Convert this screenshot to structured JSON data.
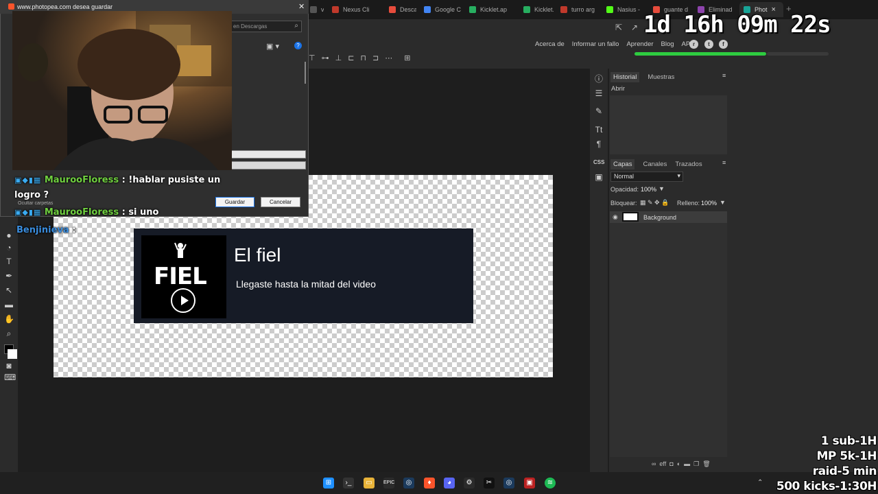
{
  "browser": {
    "tabs": [
      {
        "label": "v",
        "color": "#555"
      },
      {
        "label": "Nexus Cli",
        "color": "#c0392b"
      },
      {
        "label": "Descarga",
        "color": "#e74c3c"
      },
      {
        "label": "Google C",
        "color": "#4285f4"
      },
      {
        "label": "Kicklet.ap",
        "color": "#27ae60"
      },
      {
        "label": "Kicklet.ap",
        "color": "#27ae60"
      },
      {
        "label": "turro arg",
        "color": "#c0392b"
      },
      {
        "label": "Nasius -",
        "color": "#53fc18"
      },
      {
        "label": "guante d",
        "color": "#e74c3c"
      },
      {
        "label": "Eliminad",
        "color": "#8e44ad"
      },
      {
        "label": "Phot",
        "color": "#18a497"
      }
    ],
    "active_tab_close": "×",
    "new_tab": "+"
  },
  "photopea": {
    "menu_right": [
      "Acerca de",
      "Informar un fallo",
      "Aprender",
      "Blog",
      "API"
    ],
    "social_icons": [
      "reddit-icon",
      "twitter-icon",
      "facebook-icon"
    ],
    "progress_fraction": 0.68,
    "history_panel": {
      "tabs": [
        "Historial",
        "Muestras"
      ],
      "items": [
        "Abrir"
      ]
    },
    "layers_panel": {
      "tabs": [
        "Capas",
        "Canales",
        "Trazados"
      ],
      "blend_mode": "Normal",
      "opacity_label": "Opacidad:",
      "opacity_value": "100%",
      "lock_label": "Bloquear:",
      "fill_label": "Relleno:",
      "fill_value": "100%",
      "layers": [
        {
          "name": "Background",
          "visible": true
        }
      ]
    },
    "canvas_card": {
      "title": "El fiel",
      "subtitle": "Llegaste hasta la mitad del video",
      "logo_text": "FIEL"
    }
  },
  "save_dialog": {
    "title": "www.photopea.com desea guardar",
    "search_placeholder": "en Descargas",
    "hide_folders": "Ocultar carpetas",
    "save_button": "Guardar",
    "cancel_button": "Cancelar"
  },
  "chat": [
    {
      "user": "MaurooFloress",
      "message": ": !hablar pusiste un",
      "message_cont": "logro ?"
    },
    {
      "user": "MaurooFloress",
      "message": ": si uno"
    },
    {
      "user": "Benjinieva",
      "message": ":"
    }
  ],
  "stream": {
    "timer": "1d 16h 09m 22s",
    "goals": [
      "1 sub-1H",
      "MP 5k-1H",
      "raid-5 min",
      "500 kicks-1:30H"
    ]
  }
}
